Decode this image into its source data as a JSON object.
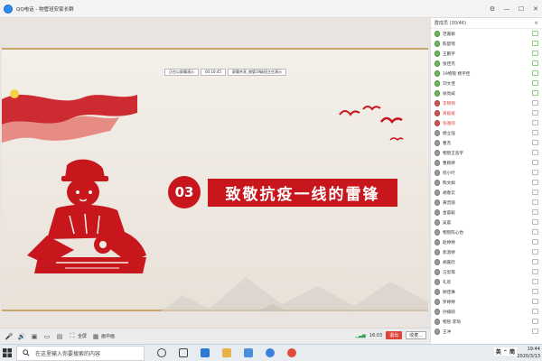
{
  "window": {
    "title": "QQ电话 - 物管班安家长群",
    "controls": [
      "⚙",
      "—",
      "☐",
      "✕"
    ]
  },
  "share_bar": {
    "status": "正在以屏幕演示",
    "time": "00:16:45",
    "label": "屏幕共享_物管19级班主任演示"
  },
  "slide": {
    "section_number": "03",
    "section_title": "致敬抗疫一线的雷锋",
    "accent_color": "#c8161d"
  },
  "toolbar": {
    "fullscreen_label": "全屏",
    "layout_label": "画中画",
    "time": "16:03",
    "exit_label": "退出",
    "more_label": "收麦..."
  },
  "panel": {
    "header": "群成员 (30/46)",
    "header_action": "⚙",
    "members": [
      {
        "name": "范嘉颖",
        "type": "green",
        "end": "green"
      },
      {
        "name": "陈楚瑶",
        "type": "green",
        "end": "green"
      },
      {
        "name": "王鹏宇",
        "type": "green",
        "end": "green"
      },
      {
        "name": "张佳杰",
        "type": "green",
        "end": "green"
      },
      {
        "name": "19物管 杨宇佳",
        "type": "green",
        "end": "green"
      },
      {
        "name": "刘文佳",
        "type": "green",
        "end": "green"
      },
      {
        "name": "徐亮威",
        "type": "green",
        "end": "green"
      },
      {
        "name": "李锦锦",
        "type": "red",
        "end": "gray",
        "admin": true
      },
      {
        "name": "黄媛媛",
        "type": "red",
        "end": "gray",
        "admin": true
      },
      {
        "name": "张雅丽",
        "type": "red",
        "end": "gray",
        "admin": true
      },
      {
        "name": "杨立强",
        "type": "gray",
        "end": "gray"
      },
      {
        "name": "曹杰",
        "type": "gray",
        "end": "gray"
      },
      {
        "name": "物管王浩宇",
        "type": "gray",
        "end": "gray"
      },
      {
        "name": "曹婉婷",
        "type": "gray",
        "end": "gray"
      },
      {
        "name": "何小叶",
        "type": "gray",
        "end": "gray"
      },
      {
        "name": "陶文娟",
        "type": "gray",
        "end": "gray"
      },
      {
        "name": "胡春云",
        "type": "gray",
        "end": "gray"
      },
      {
        "name": "黄晋丽",
        "type": "gray",
        "end": "gray"
      },
      {
        "name": "金晨毅",
        "type": "gray",
        "end": "gray"
      },
      {
        "name": "吴晨",
        "type": "gray",
        "end": "gray"
      },
      {
        "name": "物管陈心怡",
        "type": "gray",
        "end": "gray"
      },
      {
        "name": "赵婷婷",
        "type": "gray",
        "end": "gray"
      },
      {
        "name": "焦淑婷",
        "type": "gray",
        "end": "gray"
      },
      {
        "name": "胡嘉欣",
        "type": "gray",
        "end": "gray"
      },
      {
        "name": "汪思琪",
        "type": "gray",
        "end": "gray"
      },
      {
        "name": "礼欢",
        "type": "gray",
        "end": "gray"
      },
      {
        "name": "顾佳琳",
        "type": "gray",
        "end": "gray"
      },
      {
        "name": "罗婷婷",
        "type": "gray",
        "end": "gray"
      },
      {
        "name": "孙楠硕",
        "type": "gray",
        "end": "gray"
      },
      {
        "name": "物管 李琦",
        "type": "gray",
        "end": "gray"
      },
      {
        "name": "王冲",
        "type": "gray",
        "end": "gray"
      }
    ]
  },
  "taskbar": {
    "search_placeholder": "在这里输入你要搜索的内容",
    "ime": "英 ⌃ 简",
    "time": "19:44",
    "date": "2020/3/13"
  }
}
